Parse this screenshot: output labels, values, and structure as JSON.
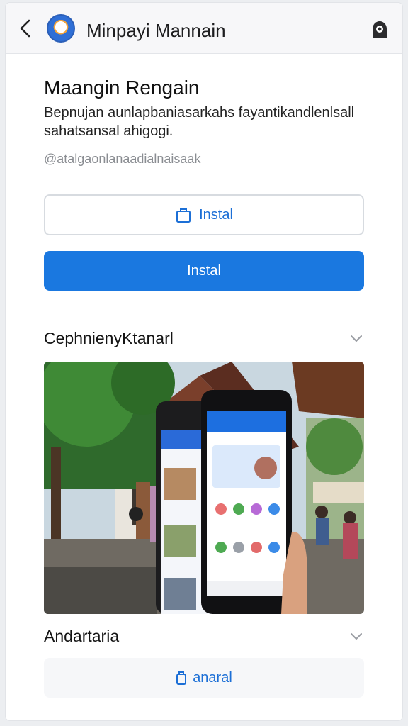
{
  "header": {
    "title": "Minpayi Mannain",
    "back_icon": "chevron-left-icon",
    "account_icon": "account-icon"
  },
  "main": {
    "heading": "Maangin Rengain",
    "description": "Bepnujan aunlapbaniasarkahs fayantikandlenlsall sahatsansal ahigogi.",
    "subline": "@atalgaonlanaadialnaisaak",
    "install_outline_label": "Instal",
    "install_primary_label": "Instal"
  },
  "sections": [
    {
      "label": "CephnienyKtanarl",
      "icon": "chevron-down-icon"
    },
    {
      "label": "Andartaria",
      "icon": "chevron-down-icon"
    }
  ],
  "footer_button": {
    "label": "anaral",
    "icon": "bag-icon"
  },
  "colors": {
    "accent": "#1a78e0",
    "link": "#1c6fd6",
    "muted": "#8a8d92"
  }
}
